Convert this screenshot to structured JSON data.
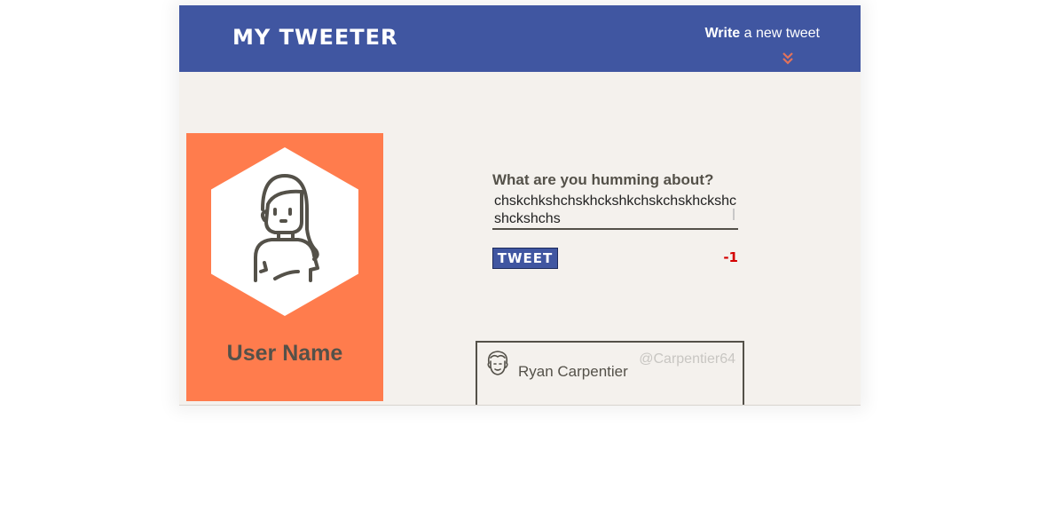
{
  "header": {
    "brand": "MY TWEETER",
    "compose_toggle_bold": "Write",
    "compose_toggle_rest": " a new tweet",
    "toggle_icon": "double-chevron-down-icon",
    "toggle_icon_color": "#e2725b"
  },
  "profile": {
    "username": "User Name",
    "avatar_icon": "girl-avatar-icon"
  },
  "composer": {
    "label": "What are you humming about?",
    "value": "chskchkshchskhckshkchskchskhckshcshckshchs",
    "submit_label": "TWEET",
    "char_counter": "-1"
  },
  "tweets": [
    {
      "name": "Ryan Carpentier",
      "handle": "@Carpentier64",
      "avatar_icon": "man-avatar-icon"
    }
  ],
  "colors": {
    "nav": "#4056a1",
    "page_bg": "#f4f1ed",
    "profile_bg": "#ff7c4d",
    "text": "#545149",
    "counter_negative": "#d40000"
  }
}
